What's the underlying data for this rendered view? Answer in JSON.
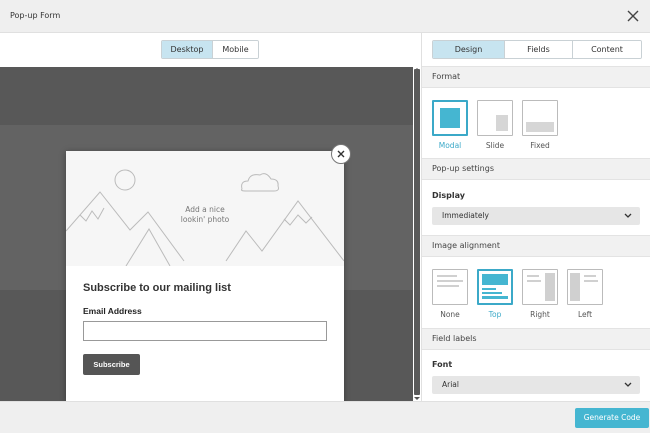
{
  "window": {
    "title": "Pop-up Form",
    "close_icon": "close-icon"
  },
  "preview": {
    "view_options": [
      "Desktop",
      "Mobile"
    ],
    "selected_view": "Desktop"
  },
  "popup": {
    "photo_placeholder_line1": "Add a nice",
    "photo_placeholder_line2": "lookin' photo",
    "heading": "Subscribe to our mailing list",
    "email_label": "Email Address",
    "email_value": "",
    "subscribe_label": "Subscribe",
    "close_icon": "close-icon"
  },
  "panel": {
    "tabs": [
      "Design",
      "Fields",
      "Content"
    ],
    "selected_tab": "Design",
    "format": {
      "header": "Format",
      "options": [
        "Modal",
        "Slide",
        "Fixed"
      ],
      "selected": "Modal"
    },
    "popup_settings": {
      "header": "Pop-up settings",
      "display_label": "Display",
      "display_value": "Immediately"
    },
    "image_alignment": {
      "header": "Image alignment",
      "options": [
        "None",
        "Top",
        "Right",
        "Left"
      ],
      "selected": "Top"
    },
    "field_labels": {
      "header": "Field labels",
      "font_label": "Font",
      "font_value": "Arial"
    }
  },
  "footer": {
    "generate_label": "Generate Code"
  },
  "colors": {
    "accent": "#45b6d1",
    "selected_border": "#3ba9c8",
    "toggle_selected": "#c7e4f0",
    "preview_bg": "#585858"
  }
}
